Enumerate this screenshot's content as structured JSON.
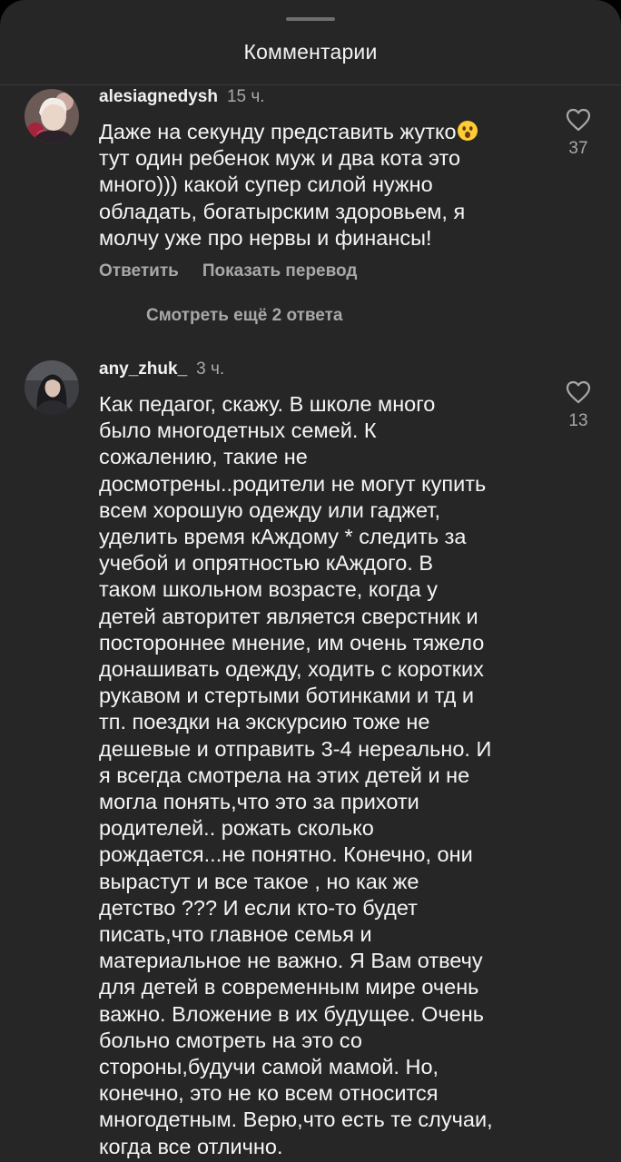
{
  "sheet": {
    "title": "Комментарии"
  },
  "comments": [
    {
      "username": "alesiagnedysh",
      "time": "15 ч.",
      "text": "Даже на секунду представить жутко",
      "text_rest": "\nтут один ребенок муж и два кота это\nмного))) какой супер силой нужно\nобладать, богатырским здоровьем, я\nмолчу уже про нервы и финансы!",
      "emoji": "surprised-face-emoji",
      "reply_label": "Ответить",
      "translate_label": "Показать перевод",
      "like_count": "37",
      "more_replies": "Смотреть ещё 2 ответа"
    },
    {
      "username": "any_zhuk_",
      "time": "3 ч.",
      "text": "Как педагог, скажу. В школе много\nбыло многодетных семей. К\nсожалению, такие не\nдосмотрены..родители не могут купить\nвсем хорошую одежду или гаджет,\nуделить время кАждому * следить за\nучебой и опрятностью кАждого. В\nтаком школьном возрасте, когда у\nдетей авторитет является сверстник и\nпостороннее мнение, им очень тяжело\nдонашивать одежду, ходить с коротких\nрукавом и стертыми ботинками и тд и\nтп. поездки на экскурсию тоже не\nдешевые и отправить 3-4 нереально. И\nя всегда смотрела на этих детей и не\nмогла понять,что это за прихоти\nродителей.. рожать сколько\nрождается...не понятно.  Конечно, они\nвырастут и все такое , но как же\nдетство ??? И если кто-то будет\nписать,что главное семья и\nматериальное не важно. Я Вам отвечу\nдля детей в современным мире очень\nважно. Вложение в их будущее. Очень\nбольно смотреть на это со\nстороны,будучи самой мамой. Но,\nконечно, это не ко всем относится\nмногодетным. Верю,что есть те случаи,\nкогда все отлично.",
      "like_count": "13"
    }
  ],
  "icons": {
    "like": "heart-outline-icon"
  },
  "colors": {
    "sheet_bg": "#262626",
    "primary_text": "#f5f5f5",
    "secondary_text": "#a8a8a8"
  }
}
